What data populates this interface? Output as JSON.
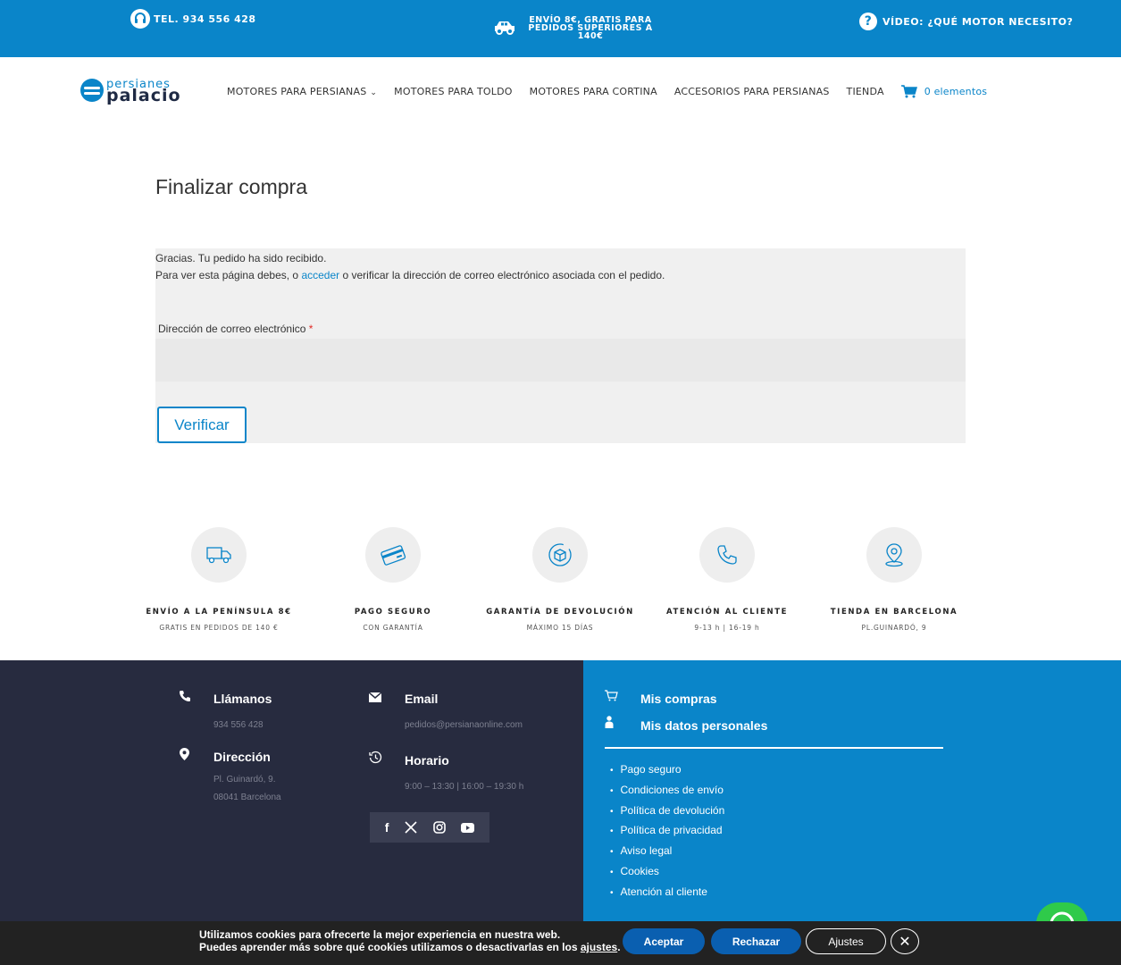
{
  "topbar": {
    "phone": "TEL. 934 556 428",
    "shipping": "ENVÍO 8€, GRATIS PARA PEDIDOS SUPERIORES A 140€",
    "video": "VÍDEO: ¿QUÉ MOTOR NECESITO?"
  },
  "logo": {
    "line1": "persianes",
    "line2": "palacio"
  },
  "nav": {
    "items": [
      "MOTORES PARA PERSIANAS",
      "MOTORES PARA TOLDO",
      "MOTORES PARA CORTINA",
      "ACCESORIOS PARA PERSIANAS",
      "TIENDA"
    ],
    "cart_label": "0 elementos"
  },
  "page": {
    "title": "Finalizar compra",
    "message1": "Gracias. Tu pedido ha sido recibido.",
    "message2_pre": "Para ver esta página debes, o ",
    "message2_link": "acceder",
    "message2_post": " o verificar la dirección de correo electrónico asociada con el pedido.",
    "email_label": "Dirección de correo electrónico",
    "required_mark": "*",
    "email_value": "",
    "verify_button": "Verificar"
  },
  "features": [
    {
      "title": "ENVÍO A LA PENÍNSULA 8€",
      "sub": "GRATIS EN PEDIDOS DE 140 €",
      "icon": "truck-icon"
    },
    {
      "title": "PAGO SEGURO",
      "sub": "CON GARANTÍA",
      "icon": "credit-card-icon"
    },
    {
      "title": "GARANTÍA DE DEVOLUCIÓN",
      "sub": "MÁXIMO 15 DÍAS",
      "icon": "return-box-icon"
    },
    {
      "title": "ATENCIÓN AL CLIENTE",
      "sub": "9-13 h | 16-19 h",
      "icon": "phone-icon"
    },
    {
      "title": "TIENDA EN BARCELONA",
      "sub": "PL.GUINARDÓ, 9",
      "icon": "location-pin-icon"
    }
  ],
  "footer": {
    "call_title": "Llámanos",
    "call_value": "934 556 428",
    "email_title": "Email",
    "email_value": "pedidos@persianaonline.com",
    "address_title": "Dirección",
    "address_line1": "Pl. Guinardó, 9.",
    "address_line2": "08041 Barcelona",
    "hours_title": "Horario",
    "hours_value": "9:00 – 13:30 | 16:00 – 19:30 h",
    "my_purchases": "Mis compras",
    "my_data": "Mis datos personales",
    "links": [
      "Pago seguro",
      "Condiciones de envío",
      "Política de devolución",
      "Política de privacidad",
      "Aviso legal",
      "Cookies",
      "Atención al cliente"
    ],
    "social": [
      "facebook-icon",
      "x-icon",
      "instagram-icon",
      "youtube-icon"
    ]
  },
  "cookie": {
    "line1": "Utilizamos cookies para ofrecerte la mejor experiencia en nuestra web.",
    "line2_pre": "Puedes aprender más sobre qué cookies utilizamos o desactivarlas en los ",
    "line2_link": "ajustes",
    "line2_post": ".",
    "accept": "Aceptar",
    "reject": "Rechazar",
    "settings": "Ajustes"
  },
  "colors": {
    "brand": "#0a85c9",
    "footer_dark": "#272b3f",
    "whatsapp": "#2fca4a"
  }
}
